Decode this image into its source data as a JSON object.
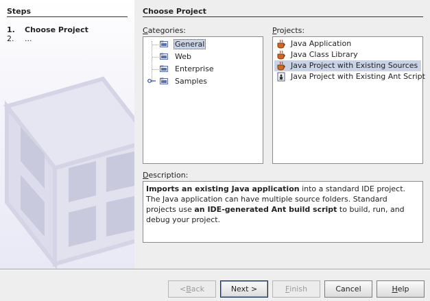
{
  "steps": {
    "title": "Steps",
    "items": [
      {
        "num": "1.",
        "label": "Choose Project"
      },
      {
        "num": "2.",
        "label": "..."
      }
    ]
  },
  "main": {
    "title": "Choose Project",
    "categories_label_u": "C",
    "categories_label_rest": "ategories:",
    "projects_label_u": "P",
    "projects_label_rest": "rojects:",
    "description_label_u": "D",
    "description_label_rest": "escription:"
  },
  "categories": [
    {
      "label": "General",
      "selected": true
    },
    {
      "label": "Web"
    },
    {
      "label": "Enterprise"
    },
    {
      "label": "Samples"
    }
  ],
  "projects": [
    {
      "label": "Java Application",
      "icon": "coffee-cup-icon"
    },
    {
      "label": "Java Class Library",
      "icon": "coffee-cup-icon"
    },
    {
      "label": "Java Project with Existing Sources",
      "icon": "coffee-cup-icon",
      "selected": true
    },
    {
      "label": "Java Project with Existing Ant Script",
      "icon": "ant-script-icon"
    }
  ],
  "description": {
    "bold1": "Imports an existing Java application",
    "text1": " into a standard IDE project. The Java application can have multiple source folders. Standard projects use ",
    "bold2": "an IDE-generated Ant build script",
    "text2": " to build, run, and debug your project."
  },
  "buttons": {
    "back_lt": "< ",
    "back_u": "B",
    "back_rest": "ack",
    "next": "Next >",
    "finish_u": "F",
    "finish_rest": "inish",
    "cancel": "Cancel",
    "help_u": "H",
    "help_rest": "elp"
  },
  "colors": {
    "selection": "#c8d3e6",
    "folder": "#5b6fa8"
  }
}
